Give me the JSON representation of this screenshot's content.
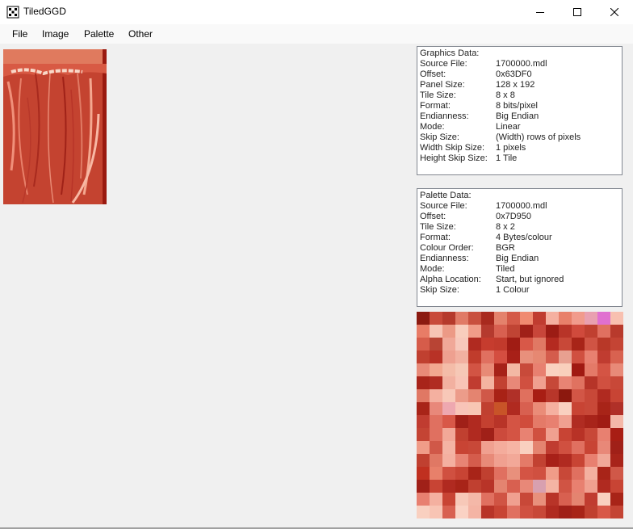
{
  "window": {
    "title": "TiledGGD",
    "app_icon": "tiledggd-app-icon",
    "controls": [
      "minimize-icon",
      "maximize-icon",
      "close-icon"
    ]
  },
  "menu": [
    {
      "label": "File"
    },
    {
      "label": "Image"
    },
    {
      "label": "Palette"
    },
    {
      "label": "Other"
    }
  ],
  "graphics_data": {
    "header": "Graphics Data:",
    "rows": [
      {
        "label": "Source File:",
        "value": "1700000.mdl"
      },
      {
        "label": "Offset:",
        "value": "0x63DF0"
      },
      {
        "label": "Panel Size:",
        "value": "128 x 192"
      },
      {
        "label": "Tile Size:",
        "value": "8 x 8"
      },
      {
        "label": "Format:",
        "value": "8 bits/pixel"
      },
      {
        "label": "Endianness:",
        "value": "Big Endian"
      },
      {
        "label": "Mode:",
        "value": "Linear"
      },
      {
        "label": "Skip Size:",
        "value": "(Width) rows of pixels"
      },
      {
        "label": "Width Skip Size:",
        "value": "1 pixels"
      },
      {
        "label": "Height Skip Size:",
        "value": "1 Tile"
      }
    ]
  },
  "palette_data": {
    "header": "Palette Data:",
    "rows": [
      {
        "label": "Source File:",
        "value": "1700000.mdl"
      },
      {
        "label": "Offset:",
        "value": "0x7D950"
      },
      {
        "label": "Tile Size:",
        "value": "8 x 2"
      },
      {
        "label": "Format:",
        "value": "4 Bytes/colour"
      },
      {
        "label": "Colour Order:",
        "value": "BGR"
      },
      {
        "label": "Endianness:",
        "value": "Big Endian"
      },
      {
        "label": "Mode:",
        "value": "Tiled"
      },
      {
        "label": "Alpha Location:",
        "value": "Start, but ignored"
      },
      {
        "label": "Skip Size:",
        "value": "1 Colour"
      }
    ]
  },
  "palette_swatches": [
    "#8b1a10",
    "#c84a3a",
    "#b53a2c",
    "#e07a66",
    "#c8503e",
    "#a82a1e",
    "#e4826c",
    "#d45a48",
    "#f08a70",
    "#c03c30",
    "#f5b0a0",
    "#e8806a",
    "#f19b8c",
    "#e9a0b0",
    "#e070d0",
    "#f8c0b0",
    "#e87c66",
    "#f7c4b4",
    "#ec9a86",
    "#f8cdbd",
    "#f09c88",
    "#b53a2e",
    "#d86050",
    "#c04434",
    "#a02018",
    "#c8463a",
    "#9c1c14",
    "#b83428",
    "#d04a3c",
    "#c04030",
    "#e07060",
    "#b83a2c",
    "#d65c4a",
    "#b84434",
    "#f0a898",
    "#f7c8bb",
    "#b02a20",
    "#c63c2e",
    "#c23a2c",
    "#a01c14",
    "#d85848",
    "#e07864",
    "#b42a20",
    "#c84838",
    "#a82418",
    "#d05444",
    "#b83828",
    "#c44434",
    "#c04030",
    "#b83226",
    "#eea090",
    "#f2b0a0",
    "#c03c2c",
    "#e07060",
    "#d44e40",
    "#a82018",
    "#e8907c",
    "#e68872",
    "#d45c4c",
    "#e8a090",
    "#d05040",
    "#e88070",
    "#c03c30",
    "#d86250",
    "#e88a78",
    "#f2a890",
    "#f4bca8",
    "#f6c8b6",
    "#d25444",
    "#e88a76",
    "#a62218",
    "#f3b8a4",
    "#c84a3a",
    "#e88070",
    "#fad2c0",
    "#f9d0bc",
    "#a01a12",
    "#e47a68",
    "#d45444",
    "#e88a78",
    "#a8241a",
    "#b02c22",
    "#f2b0a0",
    "#f8c4b6",
    "#c03c30",
    "#f4b4a0",
    "#c24232",
    "#e88878",
    "#d05040",
    "#f0a090",
    "#c64838",
    "#e88474",
    "#e07260",
    "#b63428",
    "#d05040",
    "#c84838",
    "#e07864",
    "#f4b0a0",
    "#f8c8b8",
    "#ec9c8a",
    "#e48470",
    "#d05848",
    "#a82216",
    "#b03028",
    "#e0705e",
    "#a81e14",
    "#b8362a",
    "#8c180e",
    "#d25646",
    "#c84838",
    "#b02a20",
    "#c84434",
    "#a82418",
    "#e8887a",
    "#eea8b0",
    "#f8c4b8",
    "#f8c6b4",
    "#c04030",
    "#c85428",
    "#b02a20",
    "#d86050",
    "#ea8c78",
    "#f5b0a0",
    "#f9d0c0",
    "#c84434",
    "#c84838",
    "#a82418",
    "#b03028",
    "#c03c30",
    "#e07060",
    "#d85848",
    "#a02018",
    "#b02a20",
    "#c44030",
    "#b83428",
    "#d45444",
    "#d04c3c",
    "#e47a68",
    "#e88070",
    "#f0a090",
    "#b02c22",
    "#a8241a",
    "#a01c14",
    "#f4b8a8",
    "#c44434",
    "#e07060",
    "#f2a898",
    "#c04030",
    "#b02a20",
    "#a02018",
    "#cc4a3c",
    "#d45444",
    "#e88272",
    "#d05040",
    "#f0a090",
    "#c84434",
    "#b83226",
    "#c84838",
    "#e88070",
    "#a81e14",
    "#f09c88",
    "#d05848",
    "#f4b4a4",
    "#c84434",
    "#c84838",
    "#f0a090",
    "#f4ac9c",
    "#f6b4a4",
    "#f9d0c0",
    "#e48470",
    "#c03c30",
    "#d05040",
    "#e07060",
    "#c84434",
    "#e88878",
    "#a02018",
    "#c04030",
    "#e07864",
    "#f4b0a0",
    "#e88474",
    "#d45c4c",
    "#e88a78",
    "#f0a090",
    "#f2a898",
    "#e47a68",
    "#c24232",
    "#a82018",
    "#b02a20",
    "#c84434",
    "#e88070",
    "#f0a898",
    "#a8241a",
    "#c03020",
    "#e8806a",
    "#d05040",
    "#c84434",
    "#a82418",
    "#c04030",
    "#e07060",
    "#e8907c",
    "#d45444",
    "#d05040",
    "#f09c88",
    "#c84838",
    "#e07060",
    "#f4b0a0",
    "#a82418",
    "#d05848",
    "#a02018",
    "#c84434",
    "#b02a20",
    "#a82418",
    "#c04030",
    "#b83428",
    "#e48470",
    "#d86050",
    "#e88878",
    "#d8a0b0",
    "#f4b4a4",
    "#d05444",
    "#e88070",
    "#f0a090",
    "#b02a20",
    "#c84434",
    "#e88070",
    "#f4b0a0",
    "#c84434",
    "#f7c8b8",
    "#f4b8a8",
    "#e07060",
    "#d05444",
    "#f0a090",
    "#c84838",
    "#e8907c",
    "#b83428",
    "#d86050",
    "#e48470",
    "#c03c30",
    "#f9d0c0",
    "#a82418",
    "#f9d0c0",
    "#f8c4b4",
    "#d86050",
    "#fad2c4",
    "#f4b4a4",
    "#b83428",
    "#c84434",
    "#e07060",
    "#d05040",
    "#c84838",
    "#b02a20",
    "#a02018",
    "#a82418",
    "#c04030",
    "#d85848",
    "#c44434"
  ]
}
